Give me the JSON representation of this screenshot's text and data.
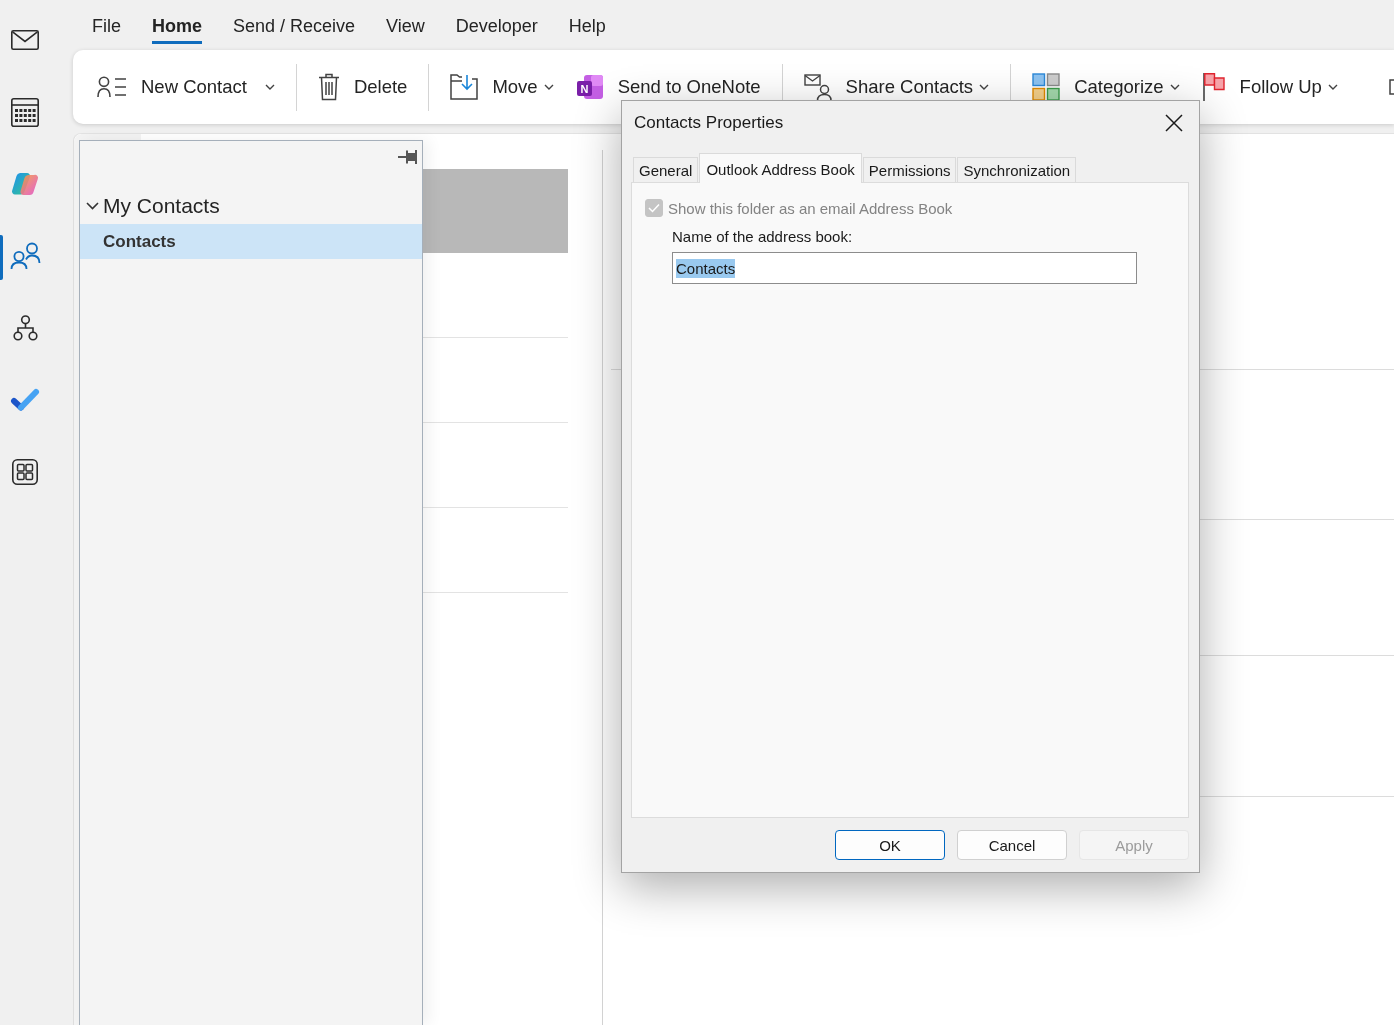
{
  "nav_bar": {
    "items": [
      {
        "kind": "mail",
        "selected": false
      },
      {
        "kind": "calendar",
        "selected": false
      },
      {
        "kind": "assistant",
        "selected": false
      },
      {
        "kind": "people",
        "selected": true
      },
      {
        "kind": "org",
        "selected": false
      },
      {
        "kind": "todo",
        "selected": false
      },
      {
        "kind": "apps",
        "selected": false
      }
    ]
  },
  "menu_tabs": [
    {
      "label": "File",
      "selected": false
    },
    {
      "label": "Home",
      "selected": true
    },
    {
      "label": "Send / Receive",
      "selected": false
    },
    {
      "label": "View",
      "selected": false
    },
    {
      "label": "Developer",
      "selected": false
    },
    {
      "label": "Help",
      "selected": false
    }
  ],
  "ribbon": {
    "groups": [
      {
        "buttons": [
          {
            "kind": "new_contact",
            "label": "New Contact",
            "dropdown": true
          }
        ]
      },
      {
        "buttons": [
          {
            "kind": "delete",
            "label": "Delete",
            "dropdown": false
          }
        ]
      },
      {
        "buttons": [
          {
            "kind": "move",
            "label": "Move",
            "dropdown": true
          },
          {
            "kind": "onenote",
            "label": "Send to OneNote",
            "dropdown": false,
            "logo_letter": "N"
          }
        ]
      },
      {
        "buttons": [
          {
            "kind": "share",
            "label": "Share Contacts",
            "dropdown": true
          }
        ]
      },
      {
        "buttons": [
          {
            "kind": "categorize",
            "label": "Categorize",
            "dropdown": true
          },
          {
            "kind": "follow_up",
            "label": "Follow Up",
            "dropdown": true
          }
        ]
      }
    ]
  },
  "folder_pane": {
    "groups": [
      {
        "label": "My Contacts",
        "expanded": true,
        "children": [
          {
            "label": "Contacts",
            "selected": true
          }
        ]
      }
    ]
  },
  "contact_list": {
    "cards": [
      {
        "selected": true
      },
      {
        "selected": false
      },
      {
        "selected": false
      },
      {
        "selected": false
      },
      {
        "selected": false
      }
    ]
  },
  "dialog": {
    "title": "Contacts Properties",
    "tabs": [
      {
        "label": "General",
        "selected": false
      },
      {
        "label": "Outlook Address Book",
        "selected": true
      },
      {
        "label": "Permissions",
        "selected": false
      },
      {
        "label": "Synchronization",
        "selected": false
      }
    ],
    "checkbox": {
      "label": "Show this folder as an email Address Book",
      "checked": true,
      "disabled": true
    },
    "address_book_field": {
      "label": "Name of the address book:",
      "value": "Contacts",
      "text_selected": true
    },
    "buttons": [
      {
        "label": "OK",
        "default": true,
        "disabled": false
      },
      {
        "label": "Cancel",
        "default": false,
        "disabled": false
      },
      {
        "label": "Apply",
        "default": false,
        "disabled": true
      }
    ]
  }
}
